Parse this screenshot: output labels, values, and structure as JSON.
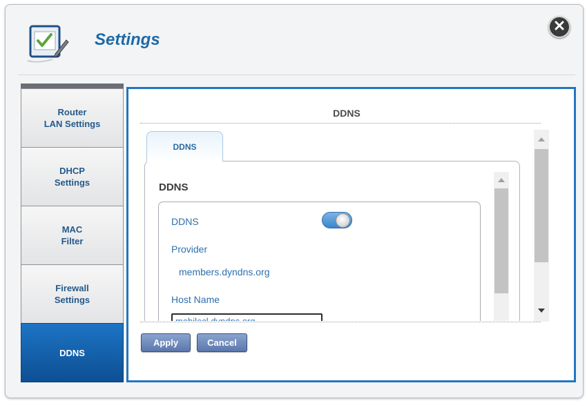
{
  "dialog": {
    "title": "Settings"
  },
  "sidebar": {
    "items": [
      {
        "label": "Router\nLAN Settings",
        "active": false
      },
      {
        "label": "DHCP\nSettings",
        "active": false
      },
      {
        "label": "MAC\nFilter",
        "active": false
      },
      {
        "label": "Firewall\nSettings",
        "active": false
      },
      {
        "label": "DDNS",
        "active": true
      }
    ]
  },
  "content": {
    "title": "DDNS",
    "tab_label": "DDNS",
    "section_heading": "DDNS",
    "fields": {
      "ddns_label": "DDNS",
      "ddns_enabled": true,
      "provider_label": "Provider",
      "provider_value": "members.dyndns.org",
      "host_name_label": "Host Name",
      "host_name_value": "mobilecl.dyndns.org"
    }
  },
  "buttons": {
    "apply": "Apply",
    "cancel": "Cancel"
  },
  "colors": {
    "accent": "#1e6aa8",
    "active_nav": "#0d4f93",
    "content_border": "#2175c0",
    "button": "#6a86bb"
  }
}
